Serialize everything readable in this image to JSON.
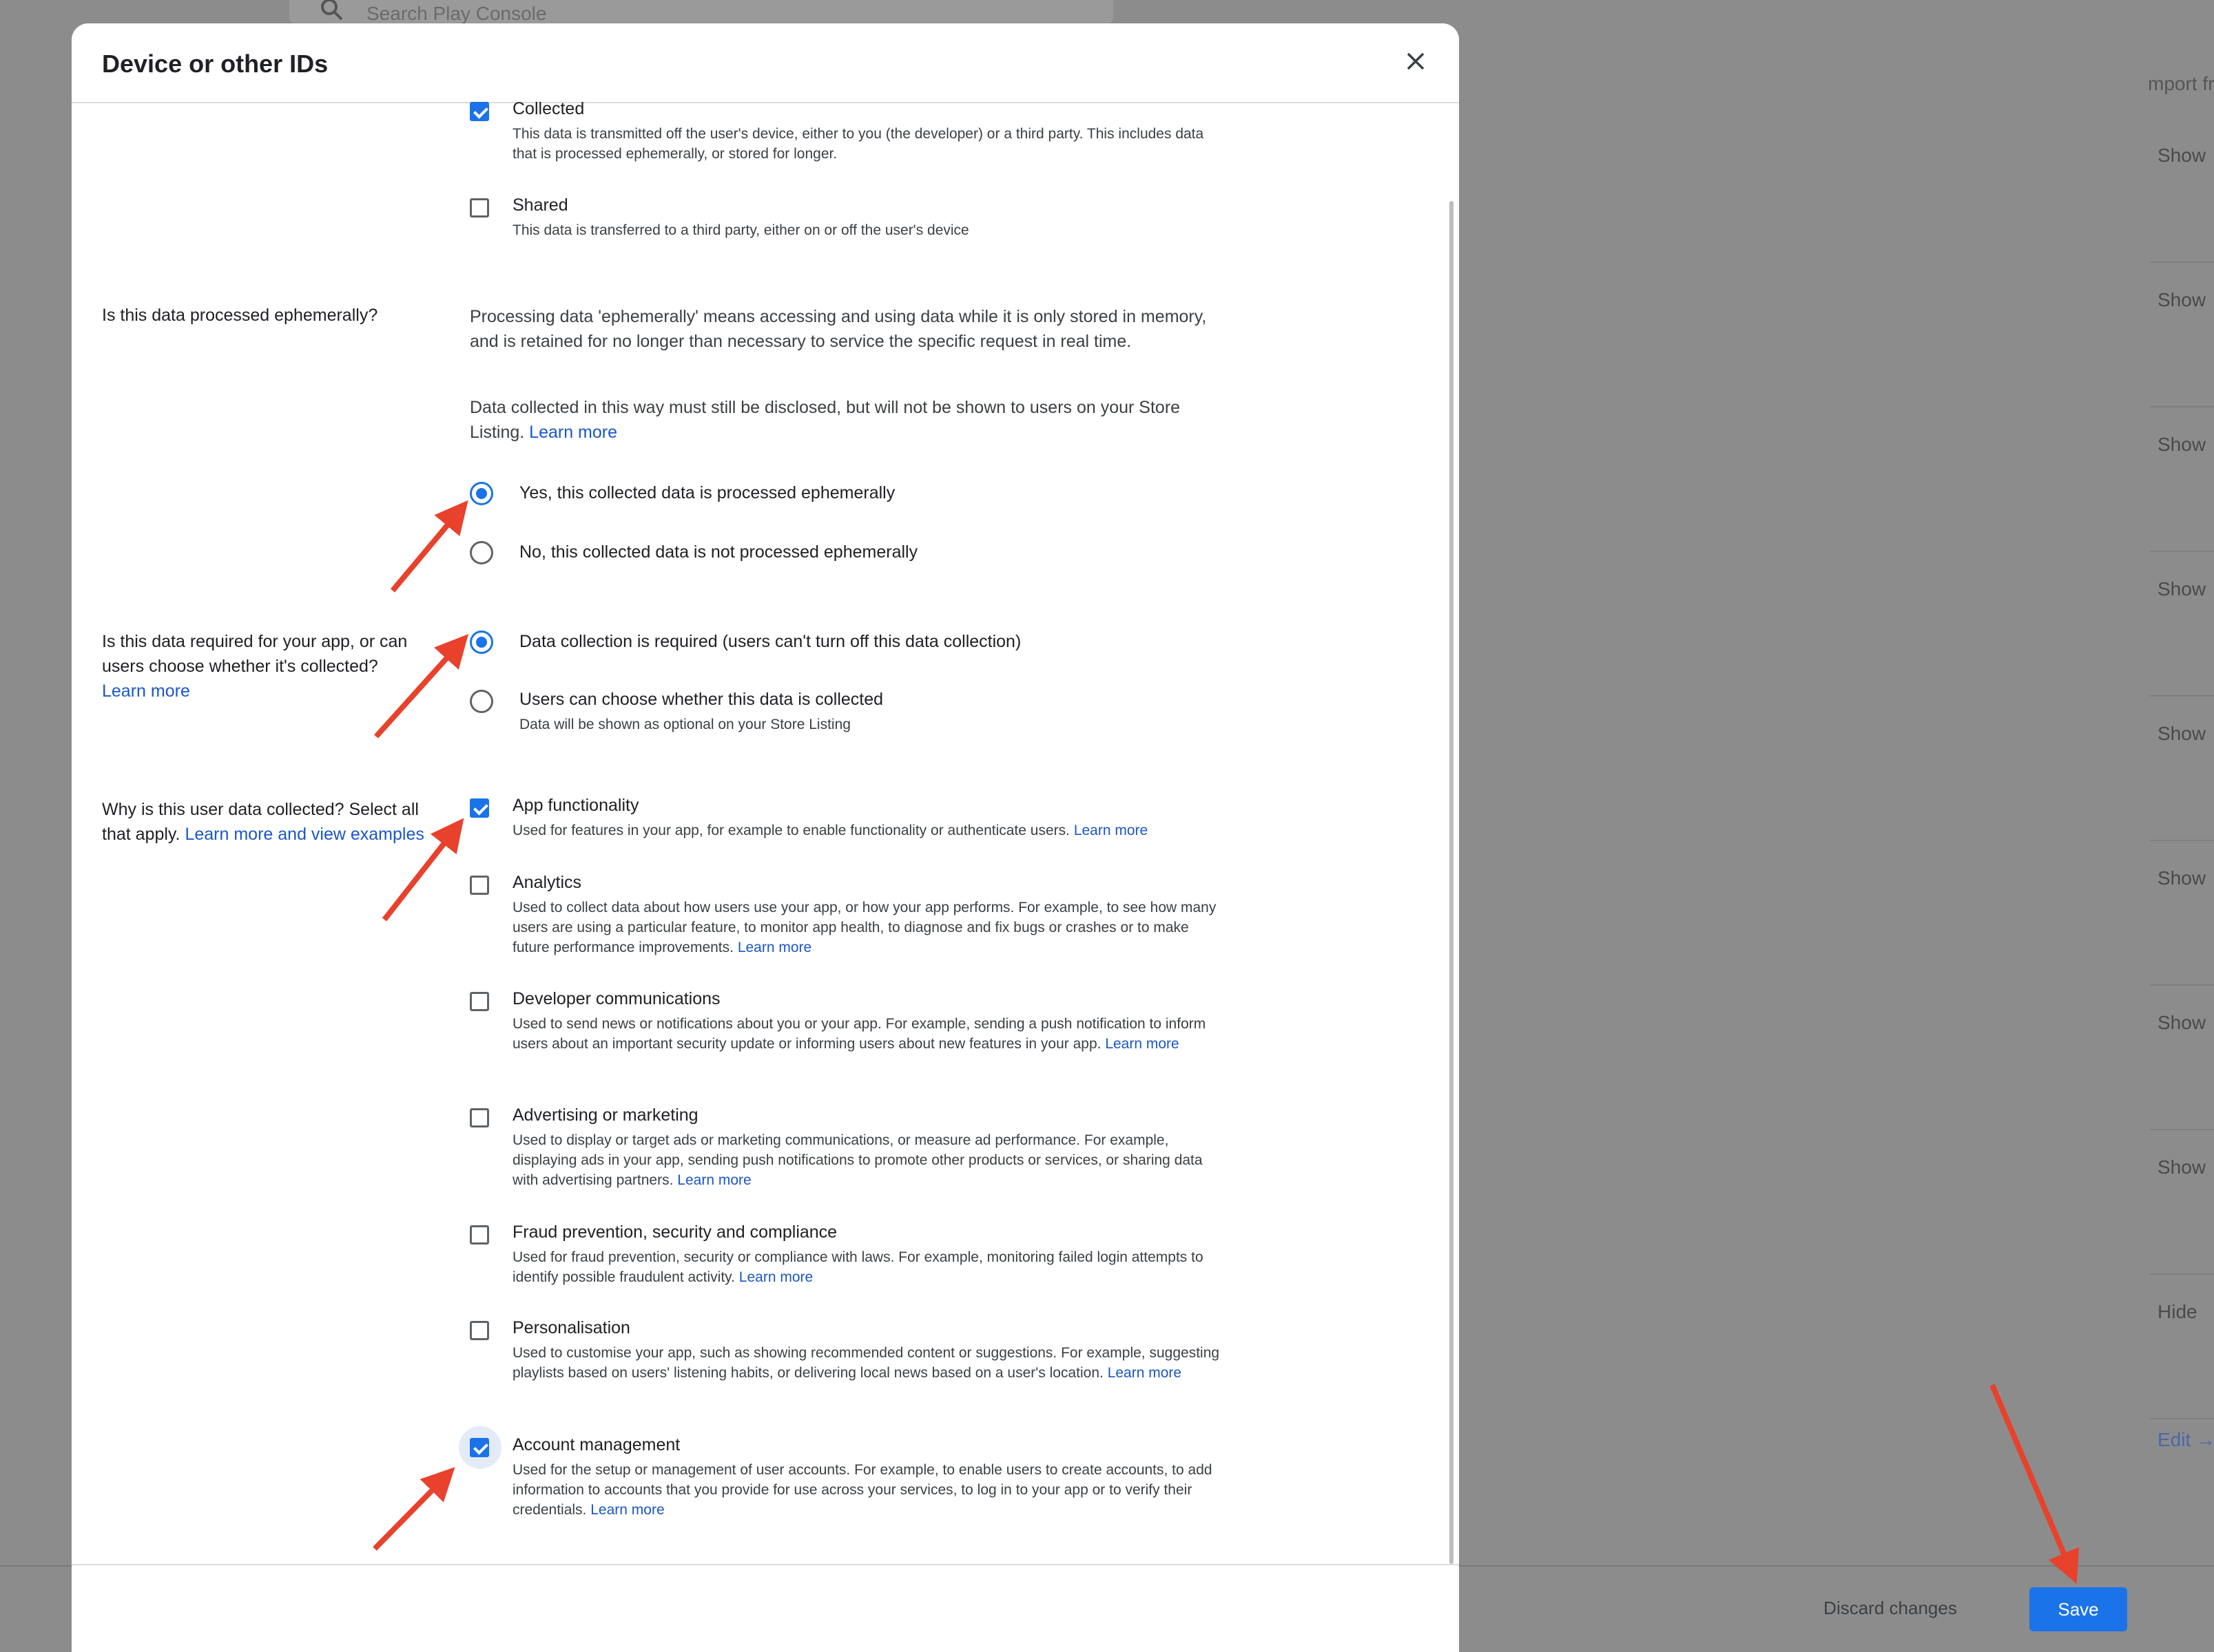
{
  "background": {
    "search_placeholder": "Search Play Console",
    "import_text": "mport fr",
    "row_actions": [
      "Show",
      "Show",
      "Show",
      "Show",
      "Show",
      "Show",
      "Show",
      "Show",
      "Hide"
    ],
    "edit_text": "Edit →"
  },
  "dialog": {
    "title": "Device or other IDs",
    "collection": {
      "collected_label": "Collected",
      "collected_desc": "This data is transmitted off the user's device, either to you (the developer) or a third party. This includes data that is processed ephemerally, or stored for longer.",
      "shared_label": "Shared",
      "shared_desc": "This data is transferred to a third party, either on or off the user's device"
    },
    "ephemeral": {
      "question": "Is this data processed ephemerally?",
      "para1": "Processing data 'ephemerally' means accessing and using data while it is only stored in memory, and is retained for no longer than necessary to service the specific request in real time.",
      "para2": "Data collected in this way must still be disclosed, but will not be shown to users on your Store Listing.",
      "para2_link": "Learn more",
      "yes": "Yes, this collected data is processed ephemerally",
      "no": "No, this collected data is not processed ephemerally",
      "selected": "yes"
    },
    "required": {
      "question": "Is this data required for your app, or can users choose whether it's collected?",
      "link": "Learn more",
      "opt_required": "Data collection is required (users can't turn off this data collection)",
      "opt_optional": "Users can choose whether this data is collected",
      "opt_optional_desc": "Data will be shown as optional on your Store Listing",
      "selected": "required"
    },
    "purpose": {
      "question": "Why is this user data collected? Select all that apply.",
      "link": "Learn more and view examples",
      "options": [
        {
          "label": "App functionality",
          "desc": "Used for features in your app, for example to enable functionality or authenticate users.",
          "link": "Learn more",
          "checked": true
        },
        {
          "label": "Analytics",
          "desc": "Used to collect data about how users use your app, or how your app performs. For example, to see how many users are using a particular feature, to monitor app health, to diagnose and fix bugs or crashes or to make future performance improvements.",
          "link": "Learn more",
          "checked": false
        },
        {
          "label": "Developer communications",
          "desc": "Used to send news or notifications about you or your app. For example, sending a push notification to inform users about an important security update or informing users about new features in your app.",
          "link": "Learn more",
          "checked": false
        },
        {
          "label": "Advertising or marketing",
          "desc": "Used to display or target ads or marketing communications, or measure ad performance. For example, displaying ads in your app, sending push notifications to promote other products or services, or sharing data with advertising partners.",
          "link": "Learn more",
          "checked": false
        },
        {
          "label": "Fraud prevention, security and compliance",
          "desc": "Used for fraud prevention, security or compliance with laws. For example, monitoring failed login attempts to identify possible fraudulent activity.",
          "link": "Learn more",
          "checked": false
        },
        {
          "label": "Personalisation",
          "desc": "Used to customise your app, such as showing recommended content or suggestions. For example, suggesting playlists based on users' listening habits, or delivering local news based on a user's location.",
          "link": "Learn more",
          "checked": false
        },
        {
          "label": "Account management",
          "desc": "Used for the setup or management of user accounts. For example, to enable users to create accounts, to add information to accounts that you provide for use across your services, to log in to your app or to verify their credentials.",
          "link": "Learn more",
          "checked": true
        }
      ]
    },
    "footer": {
      "discard_label": "Discard changes",
      "save_label": "Save"
    }
  },
  "colors": {
    "accent": "#1a73e8",
    "link": "#1a56c9",
    "annotation_arrow": "#e8412c"
  }
}
